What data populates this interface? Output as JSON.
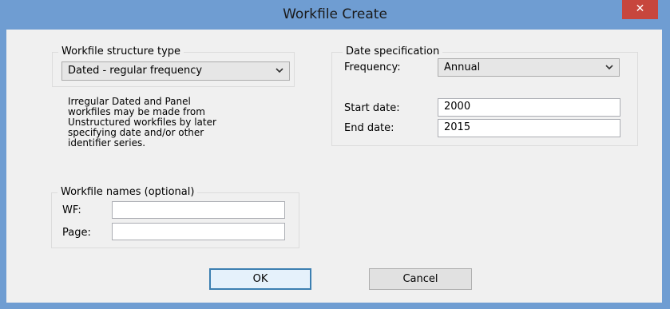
{
  "window": {
    "title": "Workfile Create",
    "close_symbol": "✕"
  },
  "structure": {
    "legend": "Workfile structure type",
    "selected": "Dated - regular frequency",
    "note_lines": [
      "Irregular Dated and Panel",
      "workfiles may be made from",
      "Unstructured workfiles by later",
      "specifying date and/or other",
      "identifier series."
    ]
  },
  "date_spec": {
    "legend": "Date specification",
    "frequency_label": "Frequency:",
    "frequency_value": "Annual",
    "start_label": "Start date:",
    "start_value": "2000",
    "end_label": "End date:",
    "end_value": "2015"
  },
  "names": {
    "legend": "Workfile names (optional)",
    "wf_label": "WF:",
    "wf_value": "",
    "page_label": "Page:",
    "page_value": ""
  },
  "buttons": {
    "ok": "OK",
    "cancel": "Cancel"
  },
  "colors": {
    "titlebar": "#6f9dd2",
    "close": "#c7463d",
    "client": "#f0f0f0"
  }
}
